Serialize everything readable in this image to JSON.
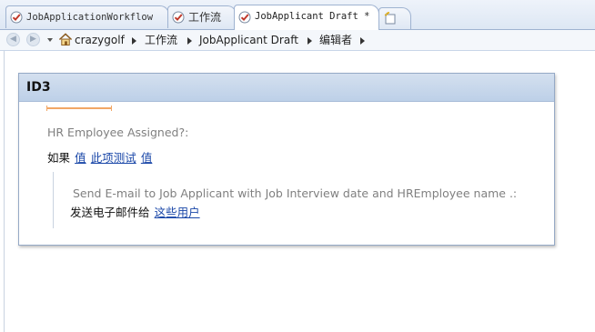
{
  "tabs": [
    {
      "label": "JobApplicationWorkflow",
      "icon": "workflow-check-icon"
    },
    {
      "label": "工作流",
      "icon": "workflow-check-icon"
    },
    {
      "label": "JobApplicant Draft *",
      "icon": "workflow-check-icon",
      "active": true
    }
  ],
  "new_tab_icon": "new-tab-icon",
  "breadcrumb": {
    "items": [
      "crazygolf",
      "工作流",
      "JobApplicant Draft",
      "编辑者"
    ],
    "home_icon": "home-icon"
  },
  "panel": {
    "title": "ID3",
    "condition_label": "HR Employee Assigned?:",
    "if_word": "如果",
    "value_link_1": "值",
    "test_link": "此项测试",
    "value_link_2": "值",
    "action_label": "Send E-mail to Job Applicant with Job Interview date and HREmployee name .:",
    "action_text": "发送电子邮件给",
    "users_link": "这些用户"
  }
}
